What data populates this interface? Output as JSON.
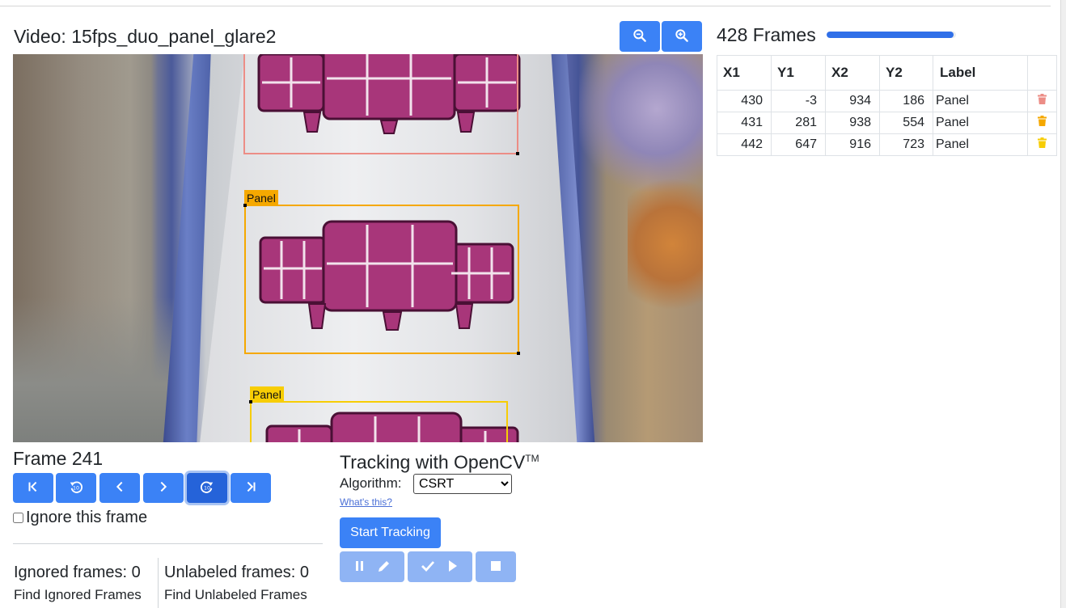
{
  "video": {
    "title": "Video: 15fps_duo_panel_glare2",
    "zoom_out_icon": "zoom-out-icon",
    "zoom_in_icon": "zoom-in-icon"
  },
  "canvas": {
    "annotations": [
      {
        "label": "Panel",
        "color": "#ec8d86"
      },
      {
        "label": "Panel",
        "color": "#f5a800"
      },
      {
        "label": "Panel",
        "color": "#f7cd05"
      }
    ]
  },
  "frames": {
    "title": "428 Frames",
    "progress": 0.98
  },
  "table": {
    "headers": [
      "X1",
      "Y1",
      "X2",
      "Y2",
      "Label",
      ""
    ],
    "rows": [
      {
        "x1": "430",
        "y1": "-3",
        "x2": "934",
        "y2": "186",
        "label": "Panel",
        "delete_icon": "trash-icon",
        "color": "#ec8d86"
      },
      {
        "x1": "431",
        "y1": "281",
        "x2": "938",
        "y2": "554",
        "label": "Panel",
        "delete_icon": "trash-icon",
        "color": "#f5a800"
      },
      {
        "x1": "442",
        "y1": "647",
        "x2": "916",
        "y2": "723",
        "label": "Panel",
        "delete_icon": "trash-icon",
        "color": "#f7cd05"
      }
    ]
  },
  "frame": {
    "title": "Frame 241",
    "nav_icons": [
      "first-frame-icon",
      "back-10-icon",
      "prev-frame-icon",
      "next-frame-icon",
      "forward-10-icon",
      "last-frame-icon"
    ],
    "ignore_label": "Ignore this frame",
    "ignored_count": "Ignored frames: 0",
    "unlabeled_count": "Unlabeled frames: 0",
    "find_ignored": "Find Ignored Frames",
    "find_unlabeled": "Find Unlabeled Frames"
  },
  "tracking": {
    "title": "Tracking with OpenCV",
    "trademark": "TM",
    "algorithm_label": "Algorithm:",
    "algorithm_value": "CSRT",
    "whats_this": "What's this?",
    "start_label": "Start Tracking",
    "colors": {
      "primary": "#3b82f6",
      "disabled": "#8fb4f4"
    }
  }
}
